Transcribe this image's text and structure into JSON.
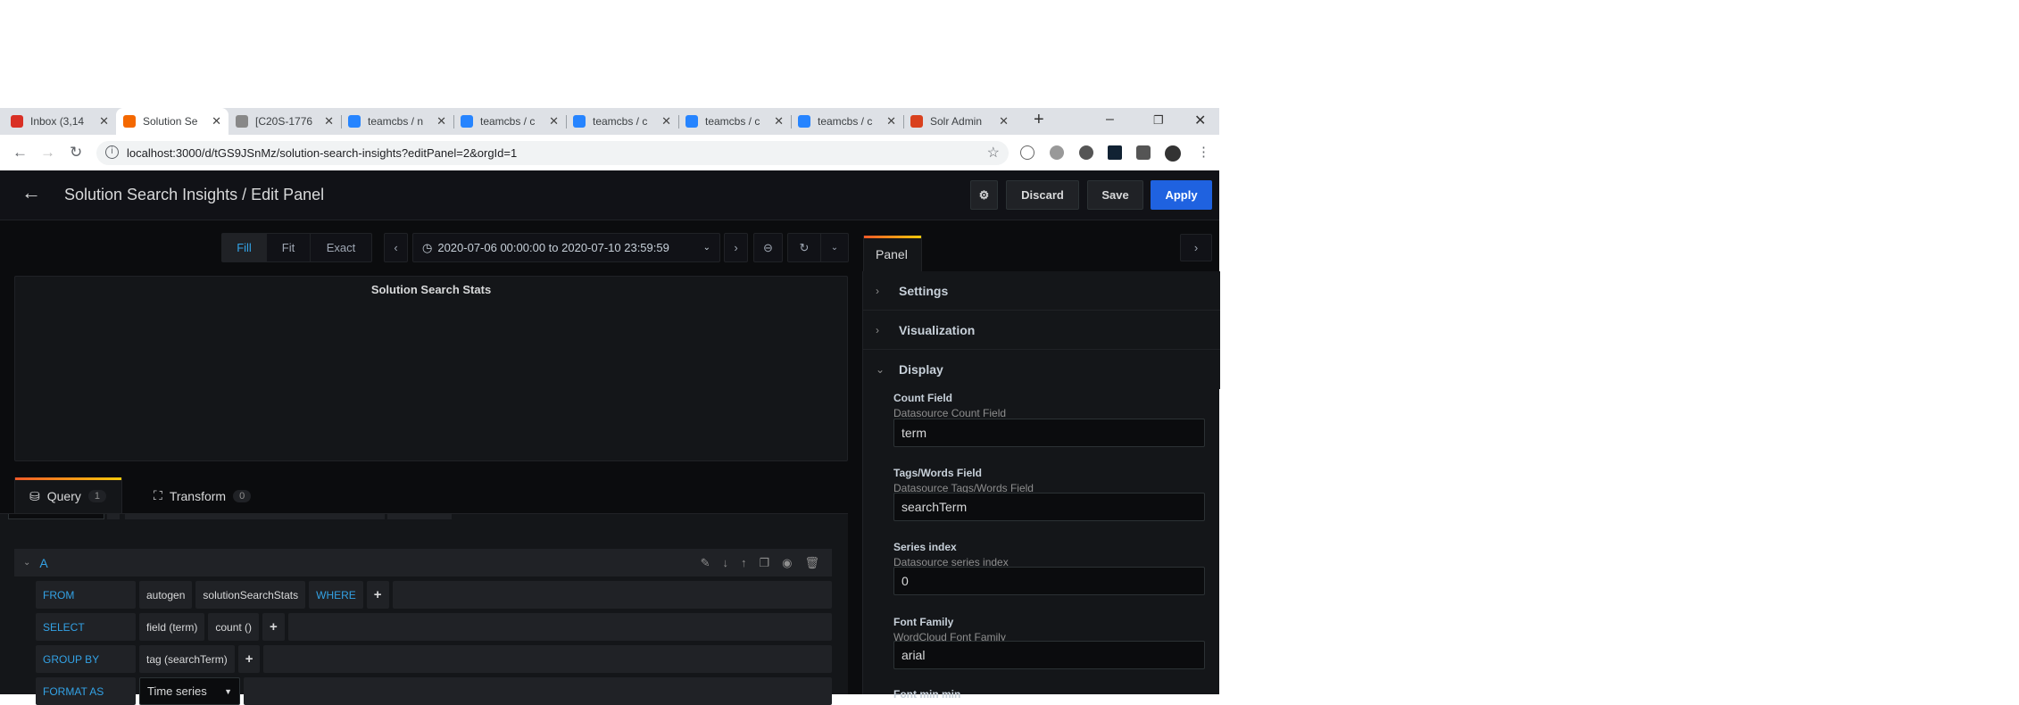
{
  "browser": {
    "tabs": [
      {
        "title": "Inbox (3,14",
        "icon": "gmail-icon",
        "color": "#d93025"
      },
      {
        "title": "Solution Se",
        "icon": "grafana-icon",
        "color": "#f46800",
        "active": true
      },
      {
        "title": "[C20S-1776",
        "icon": "jira-icon",
        "color": "#888888"
      },
      {
        "title": "teamcbs / n",
        "icon": "bitbucket-icon",
        "color": "#2684ff"
      },
      {
        "title": "teamcbs / c",
        "icon": "bitbucket-icon",
        "color": "#2684ff"
      },
      {
        "title": "teamcbs / c",
        "icon": "bitbucket-icon",
        "color": "#2684ff"
      },
      {
        "title": "teamcbs / c",
        "icon": "bitbucket-icon",
        "color": "#2684ff"
      },
      {
        "title": "teamcbs / c",
        "icon": "bitbucket-icon",
        "color": "#2684ff"
      },
      {
        "title": "Solr Admin",
        "icon": "solr-icon",
        "color": "#d9411e"
      }
    ],
    "new_tab": "+",
    "url": "localhost:3000/d/tGS9JSnMz/solution-search-insights?editPanel=2&orgId=1"
  },
  "header": {
    "title": "Solution Search Insights / Edit Panel",
    "discard": "Discard",
    "save": "Save",
    "apply": "Apply"
  },
  "toolbar": {
    "fill": "Fill",
    "fit": "Fit",
    "exact": "Exact",
    "time_range": "2020-07-06 00:00:00 to 2020-07-10 23:59:59"
  },
  "panel": {
    "title": "Solution Search Stats"
  },
  "query_tabs": [
    {
      "label": "Query",
      "count": "1"
    },
    {
      "label": "Transform",
      "count": "0"
    }
  ],
  "query": {
    "ref": "A",
    "rows": {
      "from": {
        "label": "FROM",
        "policy": "autogen",
        "measurement": "solutionSearchStats",
        "where": "WHERE"
      },
      "select": {
        "label": "SELECT",
        "field": "field (term)",
        "fn": "count ()"
      },
      "group_by": {
        "label": "GROUP BY",
        "tag": "tag (searchTerm)"
      },
      "format_as": {
        "label": "FORMAT AS",
        "value": "Time series"
      }
    },
    "plus": "+"
  },
  "options": {
    "tab": "Panel",
    "sections": {
      "settings": "Settings",
      "visualization": "Visualization",
      "display": "Display"
    },
    "fields": [
      {
        "label": "Count Field",
        "sub": "Datasource Count Field",
        "value": "term"
      },
      {
        "label": "Tags/Words Field",
        "sub": "Datasource Tags/Words Field",
        "value": "searchTerm"
      },
      {
        "label": "Series index",
        "sub": "Datasource series index",
        "value": "0"
      },
      {
        "label": "Font Family",
        "sub": "WordCloud Font Family",
        "value": "arial"
      }
    ],
    "next_label": "Font min min"
  }
}
